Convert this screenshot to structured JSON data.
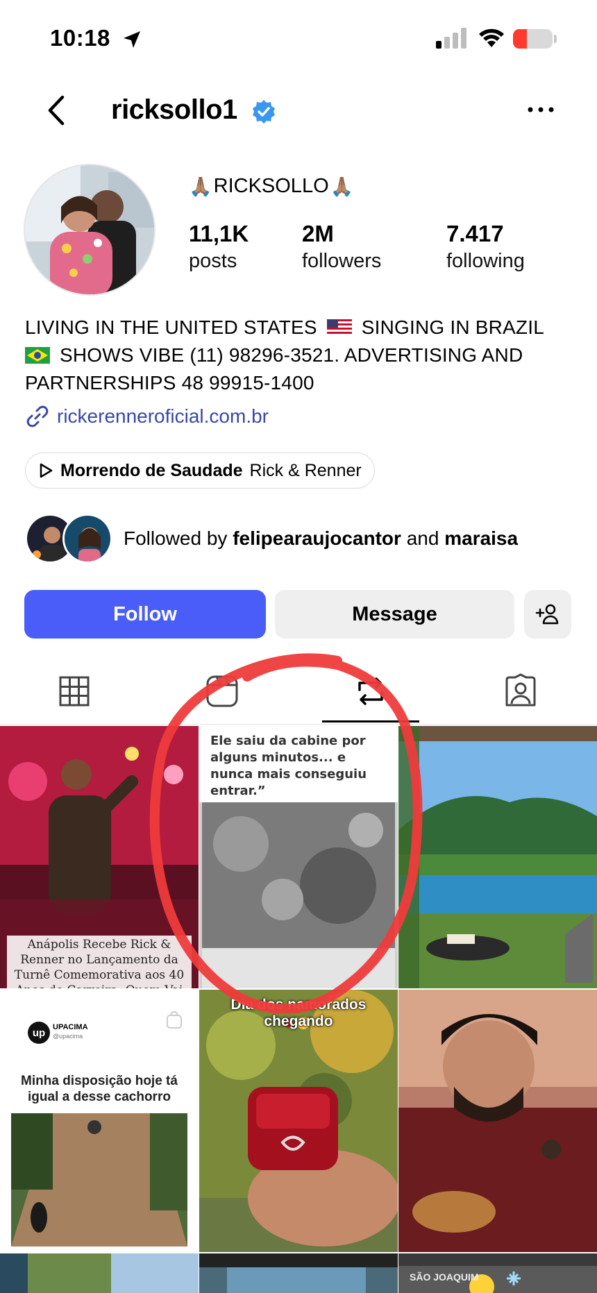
{
  "status_bar": {
    "time": "10:18",
    "battery_level": 0.35
  },
  "header": {
    "username": "ricksollo1",
    "back_icon": "chevron-left-icon",
    "more_icon": "more-horizontal-icon"
  },
  "profile": {
    "display_name": "RICKSOLLO",
    "display_emoji": "🙏🏽",
    "stats": [
      {
        "value": "11,1K",
        "label": "posts"
      },
      {
        "value": "2M",
        "label": "followers"
      },
      {
        "value": "7.417",
        "label": "following"
      }
    ],
    "bio_line1_a": "LIVING IN THE UNITED STATES",
    "bio_line1_b": "SINGING IN BRAZIL",
    "bio_line2": "SHOWS VIBE (11) 98296-3521. ADVERTISING AND",
    "bio_line3": "PARTNERSHIPS 48 99915-1400",
    "link": "rickerenneroficial.com.br",
    "music_title": "Morrendo de Saudade",
    "music_artist": "Rick & Renner",
    "followed_prefix": "Followed by",
    "followed_user1": "felipearaujocantor",
    "followed_and": "and",
    "followed_user2": "maraisa"
  },
  "actions": {
    "follow": "Follow",
    "message": "Message"
  },
  "grid": {
    "post1_caption": "Anápolis Recebe Rick & Renner no Lançamento da Turnê Comemorativa aos 40 Anos de Carreira: Quem Vai com Você?",
    "post2_caption": "Ele saiu da cabine por alguns minutos... e nunca mais conseguiu entrar.”",
    "post4_brand": "UPACIMA",
    "post4_handle": "@upacima",
    "post4_caption": "Minha disposição hoje tá igual a desse cachorro",
    "post5_caption": "Dia dos namorados chegando",
    "post9_label": "SÃO JOAQUIM"
  },
  "colors": {
    "follow_blue": "#4a5df9",
    "link_blue": "#3847a8",
    "verified_blue": "#3897f0",
    "annotation_red": "#ef3b3b"
  }
}
